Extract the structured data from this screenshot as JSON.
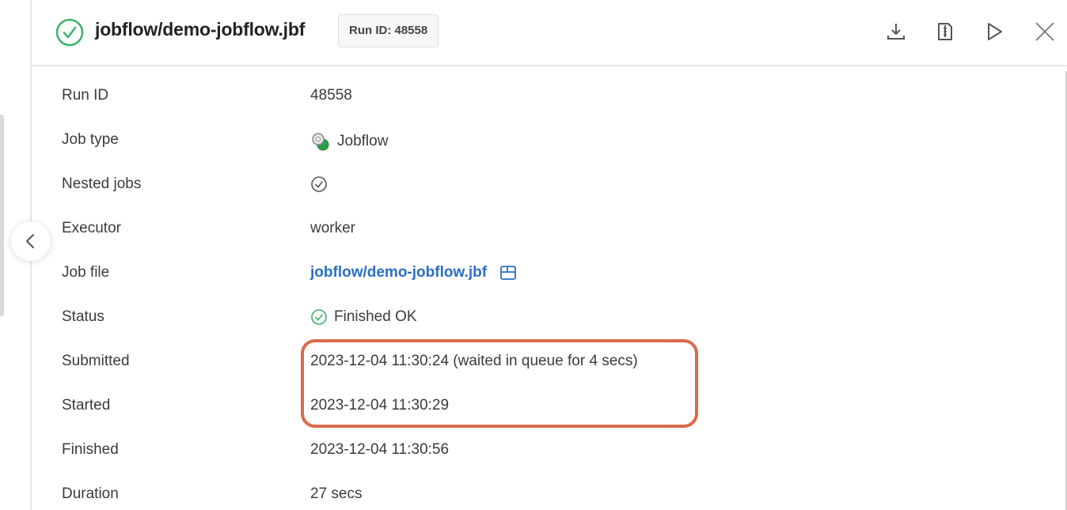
{
  "header": {
    "title": "jobflow/demo-jobflow.jbf",
    "run_id_badge": "Run ID: 48558",
    "actions": [
      {
        "name": "download",
        "icon": "download-icon"
      },
      {
        "name": "log",
        "icon": "log-file-icon"
      },
      {
        "name": "run",
        "icon": "play-icon"
      },
      {
        "name": "close",
        "icon": "close-icon"
      }
    ]
  },
  "details": {
    "run_id": {
      "label": "Run ID",
      "value": "48558"
    },
    "job_type": {
      "label": "Job type",
      "value": "Jobflow",
      "icon": "jobflow-gears-icon"
    },
    "nested_jobs": {
      "label": "Nested jobs",
      "icon": "check-circle-icon"
    },
    "executor": {
      "label": "Executor",
      "value": "worker"
    },
    "job_file": {
      "label": "Job file",
      "value": "jobflow/demo-jobflow.jbf",
      "icon": "open-in-window-icon"
    },
    "status": {
      "label": "Status",
      "value": "Finished OK",
      "icon": "check-circle-green-icon"
    },
    "submitted": {
      "label": "Submitted",
      "value": "2023-12-04 11:30:24 (waited in queue for 4 secs)"
    },
    "started": {
      "label": "Started",
      "value": "2023-12-04 11:30:29"
    },
    "finished": {
      "label": "Finished",
      "value": "2023-12-04 11:30:56"
    },
    "duration": {
      "label": "Duration",
      "value": "27 secs"
    }
  },
  "colors": {
    "ok_green": "#3bb26b",
    "link_blue": "#2a6fc4",
    "highlight": "#d96a4b"
  }
}
